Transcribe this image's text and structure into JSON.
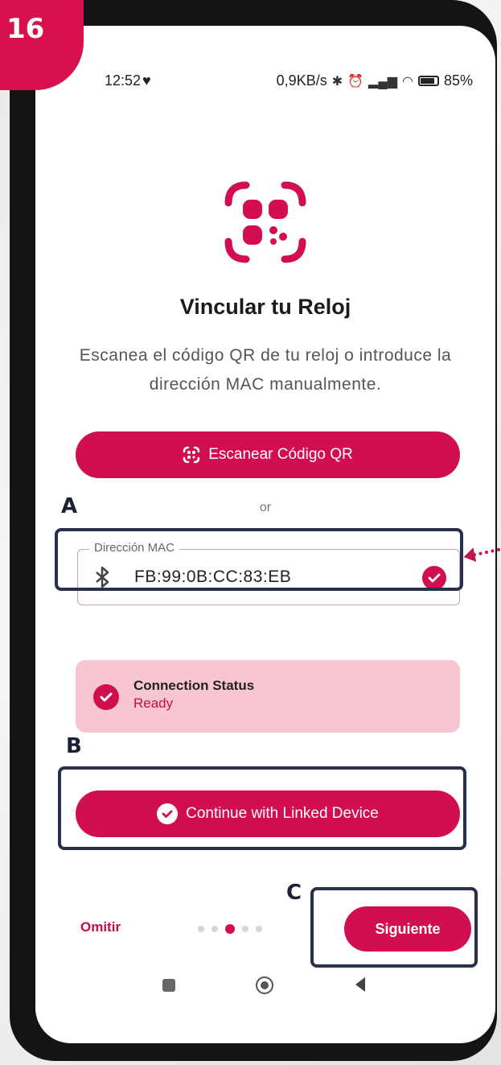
{
  "step_badge": "16",
  "status_bar": {
    "time": "12:52",
    "right_text": "0,9KB/s",
    "battery": "85"
  },
  "main": {
    "title": "Vincular tu Reloj",
    "subtitle": "Escanea el código QR de tu reloj o introduce la dirección MAC manualmente.",
    "scan_button_label": "Escanear Código QR",
    "or_label": "or",
    "mac_field": {
      "label": "Dirección MAC",
      "value": "FB:99:0B:CC:83:EB"
    },
    "connection_status": {
      "title": "Connection Status",
      "value": "Ready"
    },
    "continue_button_label": "Continue with Linked Device"
  },
  "bottom_nav": {
    "skip_label": "Omitir",
    "next_label": "Siguiente",
    "total_steps": 5,
    "current_step": 3
  },
  "annotations": {
    "a": "A",
    "b": "B",
    "c": "C"
  },
  "colors": {
    "accent": "#d20f4e",
    "status_card_bg": "#f8c5d3",
    "annotation_box": "#2a2f4c"
  }
}
